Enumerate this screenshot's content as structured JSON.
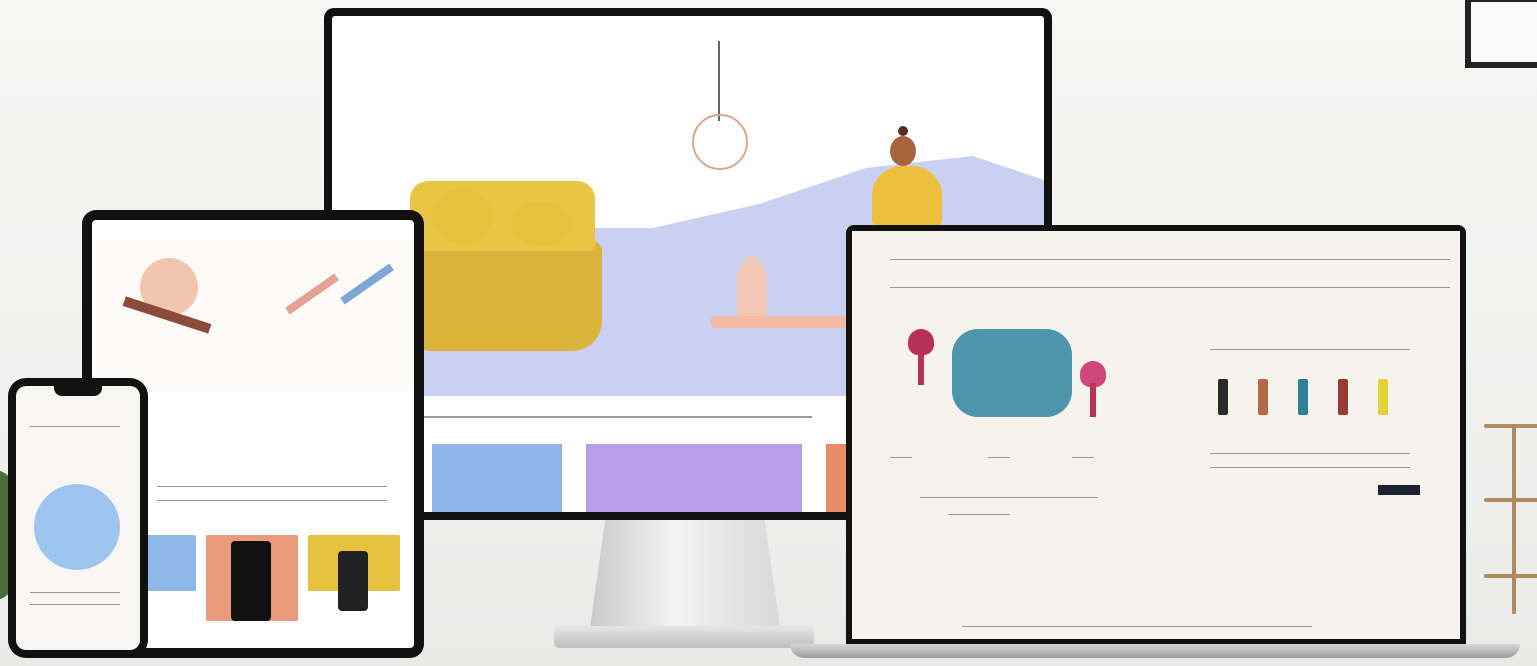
{
  "monitor": {
    "logo": "",
    "nav": [],
    "hero": {
      "title": "",
      "subtitle": ""
    },
    "section_label": "",
    "tiles": [
      {
        "color": "#8fb4e8"
      },
      {
        "color": "#b79ee8"
      },
      {
        "color": "#e88b67"
      }
    ]
  },
  "tablet": {
    "hero_title": "",
    "section_title": "",
    "section_subtitle": "",
    "cards": [
      {
        "color": "#8eb8e8"
      },
      {
        "color": "#e89a7a"
      },
      {
        "color": "#e7c13d"
      }
    ]
  },
  "phone": {
    "title": ""
  },
  "laptop": {
    "logo": "",
    "breadcrumb": "",
    "product_labels": [],
    "swatch_colors": [
      "#2b2b2b",
      "#b5674a",
      "#2d7f9a",
      "#9a3a35",
      "#e3d13a"
    ],
    "quantity_label": "",
    "cta_label": "",
    "related_labels": [],
    "footer_label": ""
  }
}
